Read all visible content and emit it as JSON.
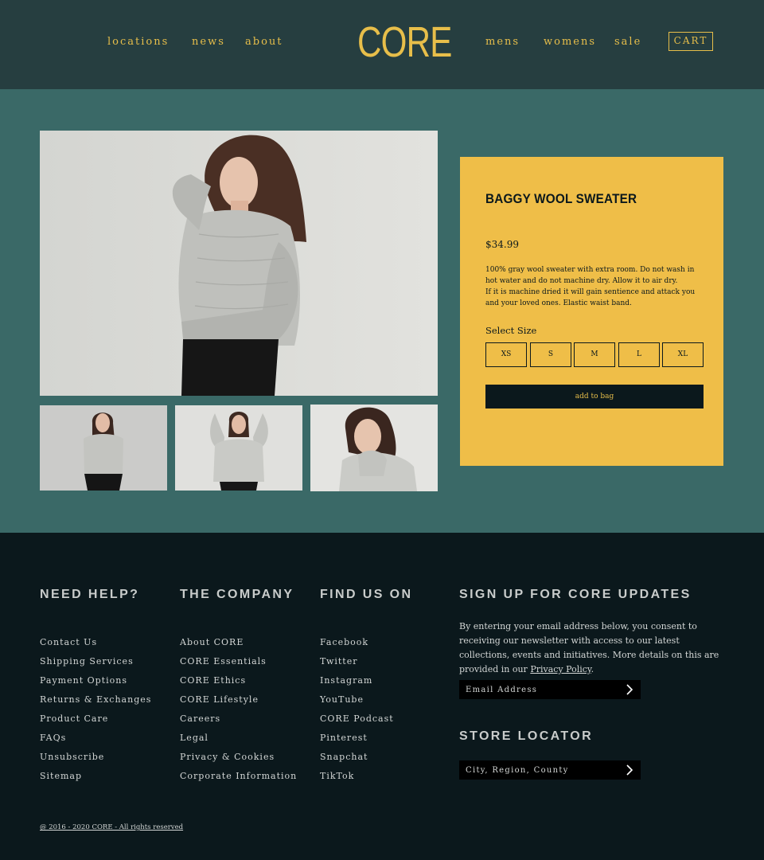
{
  "header": {
    "nav_left": [
      "locations",
      "news",
      "about"
    ],
    "logo": "CORE",
    "nav_right": [
      "mens",
      "womens",
      "sale"
    ],
    "cart_label": "CART"
  },
  "product": {
    "images": [
      {
        "name": "main-photo",
        "icon": "model-in-gray-sweater-photo"
      },
      {
        "name": "thumbnail-1",
        "icon": "model-standing-photo"
      },
      {
        "name": "thumbnail-2",
        "icon": "model-arms-raised-photo"
      },
      {
        "name": "thumbnail-3",
        "icon": "model-smiling-photo"
      }
    ],
    "title": "BAGGY WOOL SWEATER",
    "price": "$34.99",
    "description": [
      "100% gray wool sweater with extra room. Do not wash in hot water and do not machine dry. Allow it to air dry.",
      "If it is machine dried it will gain sentience and attack you and your loved ones. Elastic waist band."
    ],
    "size_label": "Select Size",
    "sizes": [
      "XS",
      "S",
      "M",
      "L",
      "XL"
    ],
    "add_to_bag": "add to bag"
  },
  "footer": {
    "help": {
      "heading": "NEED HELP?",
      "links": [
        "Contact Us",
        "Shipping Services",
        "Payment Options",
        "Returns & Exchanges",
        "Product Care",
        "FAQs",
        "Unsubscribe",
        "Sitemap"
      ]
    },
    "company": {
      "heading": "THE COMPANY",
      "links": [
        "About CORE",
        "CORE Essentials",
        "CORE Ethics",
        "CORE Lifestyle",
        "Careers",
        "Legal",
        "Privacy & Cookies",
        "Corporate Information"
      ]
    },
    "find_us": {
      "heading": "FIND US ON",
      "links": [
        "Facebook",
        "Twitter",
        "Instagram",
        "YouTube",
        "CORE Podcast",
        "Pinterest",
        "Snapchat",
        "TikTok"
      ]
    },
    "signup": {
      "heading": "SIGN UP FOR CORE UPDATES",
      "text": "By entering your email address below, you consent to receiving our newsletter with access to our latest collections, events and initiatives. More details on this are provided in our",
      "policy_link": "Privacy Policy",
      "text_end": ".",
      "email_placeholder": "Email Address",
      "email_value": ""
    },
    "store_locator": {
      "heading": "STORE LOCATOR",
      "placeholder": "City, Region, County",
      "value": ""
    },
    "copyright": "@ 2016 - 2020 CORE - All rights reserved"
  },
  "colors": {
    "header_bg": "#263e40",
    "section_bg": "#3a6967",
    "accent": "#e7be4a",
    "panel": "#efbe48",
    "footer_bg": "#0b181c"
  }
}
